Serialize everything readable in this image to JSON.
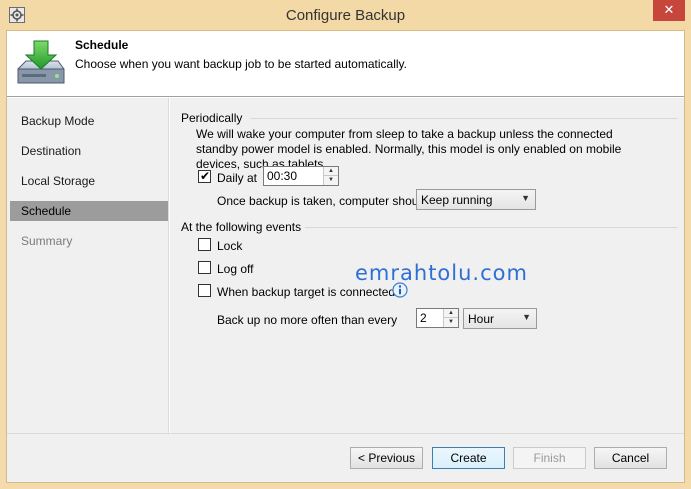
{
  "window": {
    "title": "Configure Backup",
    "close_symbol": "✕",
    "app_icon": "gear-icon"
  },
  "header": {
    "title": "Schedule",
    "description": "Choose when you want backup job to be started automatically.",
    "icon": "backup-drive-download-icon"
  },
  "nav": {
    "items": [
      {
        "label": "Backup Mode",
        "state": "normal"
      },
      {
        "label": "Destination",
        "state": "normal"
      },
      {
        "label": "Local Storage",
        "state": "normal"
      },
      {
        "label": "Schedule",
        "state": "selected"
      },
      {
        "label": "Summary",
        "state": "disabled"
      }
    ]
  },
  "periodically": {
    "section_label": "Periodically",
    "description": "We will wake your computer from sleep to take a backup unless the connected standby power model is enabled. Normally, this model is only enabled on mobile devices, such as tablets.",
    "daily": {
      "label": "Daily at",
      "checked": true,
      "time": "00:30"
    },
    "after_backup": {
      "label": "Once backup is taken, computer should",
      "selected": "Keep running"
    }
  },
  "events": {
    "section_label": "At the following events",
    "lock": {
      "label": "Lock",
      "checked": false
    },
    "logoff": {
      "label": "Log off",
      "checked": false
    },
    "target_connected": {
      "label": "When backup target is connected",
      "checked": false,
      "info_icon": "info-icon"
    },
    "frequency": {
      "label": "Back up no more often than every",
      "value": "2",
      "unit": "Hour"
    }
  },
  "watermark": "emrahtolu.com",
  "footer": {
    "previous": "< Previous",
    "create": "Create",
    "finish": "Finish",
    "cancel": "Cancel"
  },
  "colors": {
    "titlebar": "#f3d9a6",
    "close_button": "#c7463c",
    "nav_selected": "#9c9c9c",
    "watermark": "#2e6fd6"
  }
}
